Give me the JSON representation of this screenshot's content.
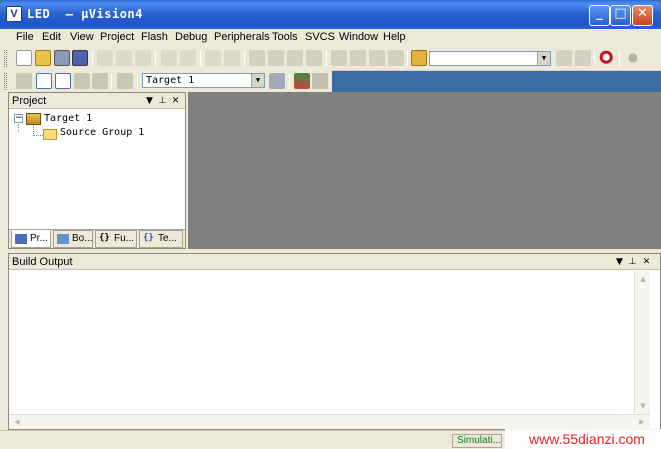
{
  "window": {
    "title": "LED  – μVision4",
    "logo": "V",
    "controls": {
      "minimize": "_",
      "maximize": "□",
      "close": "✕"
    }
  },
  "menu": [
    "File",
    "Edit",
    "View",
    "Project",
    "Flash",
    "Debug",
    "Peripherals",
    "Tools",
    "SVCS",
    "Window",
    "Help"
  ],
  "toolbar2": {
    "target_select": "Target 1"
  },
  "project_panel": {
    "title": "Project",
    "tree": {
      "root": "Target 1",
      "child": "Source Group 1",
      "expander": "−"
    },
    "tabs": [
      "Pr...",
      "Bo...",
      "Fu...",
      "Te..."
    ],
    "tab_icons": [
      "project-icon",
      "books-icon",
      "braces-icon",
      "templates-icon"
    ]
  },
  "build_output": {
    "title": "Build Output"
  },
  "status": {
    "mode": "Simulati..."
  },
  "watermark": "www.55dianzi.com",
  "colors": {
    "titlebar": "#2a63d2",
    "workspace": "#808080",
    "chrome": "#ece9d8",
    "accent_red": "#e0212c"
  }
}
